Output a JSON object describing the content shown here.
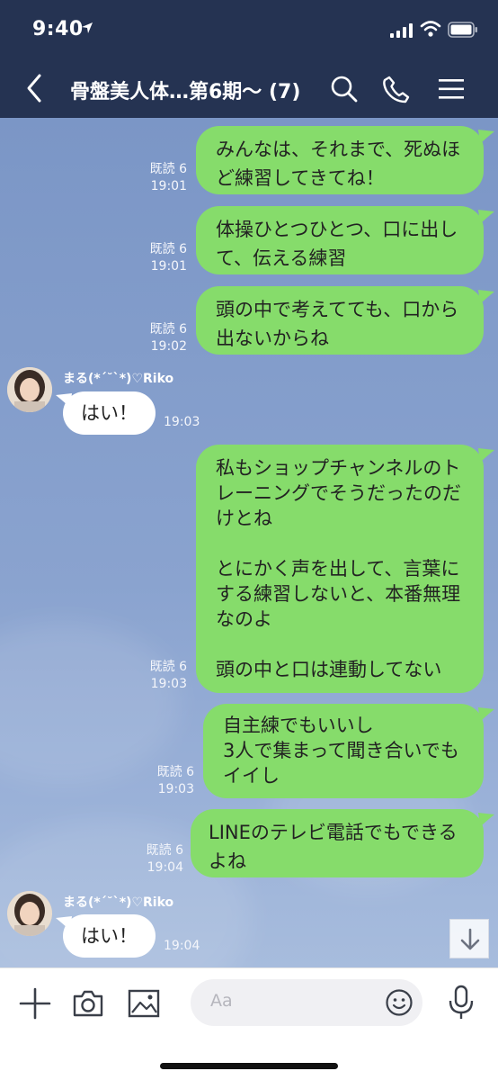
{
  "status": {
    "time": "9:40"
  },
  "header": {
    "title": "骨盤美人体…第6期〜 (7)"
  },
  "messages": [
    {
      "side": "out",
      "text": "みんなは、それまで、死ぬほ\nど練習してきてね！",
      "read": "既読 6",
      "time": "19:01"
    },
    {
      "side": "out",
      "text": "体操ひとつひとつ、口に出し\nて、伝える練習",
      "read": "既読 6",
      "time": "19:01"
    },
    {
      "side": "out",
      "text": "頭の中で考えてても、口から\n出ないからね",
      "read": "既読 6",
      "time": "19:02"
    },
    {
      "side": "in",
      "sender": "まる(*´˘`*)♡Riko",
      "text": "はい！",
      "time": "19:03"
    },
    {
      "side": "out",
      "text": "私もショップチャンネルのト\nレーニングでそうだったのだ\nけとね\n\nとにかく声を出して、言葉に\nする練習しないと、本番無理\nなのよ\n\n頭の中と口は連動してない",
      "read": "既読 6",
      "time": "19:03"
    },
    {
      "side": "out",
      "text": "自主練でもいいし\n3人で集まって聞き合いでも\nイイし",
      "read": "既読 6",
      "time": "19:03"
    },
    {
      "side": "out",
      "text": "LINEのテレビ電話でもできる\nよね",
      "read": "既読 6",
      "time": "19:04"
    },
    {
      "side": "in",
      "sender": "まる(*´˘`*)♡Riko",
      "text": "はい！",
      "time": "19:04"
    }
  ],
  "input": {
    "placeholder": "Aa"
  },
  "colors": {
    "header": "#253352",
    "outgoing_bubble": "#86dc6b",
    "incoming_bubble": "#ffffff"
  }
}
